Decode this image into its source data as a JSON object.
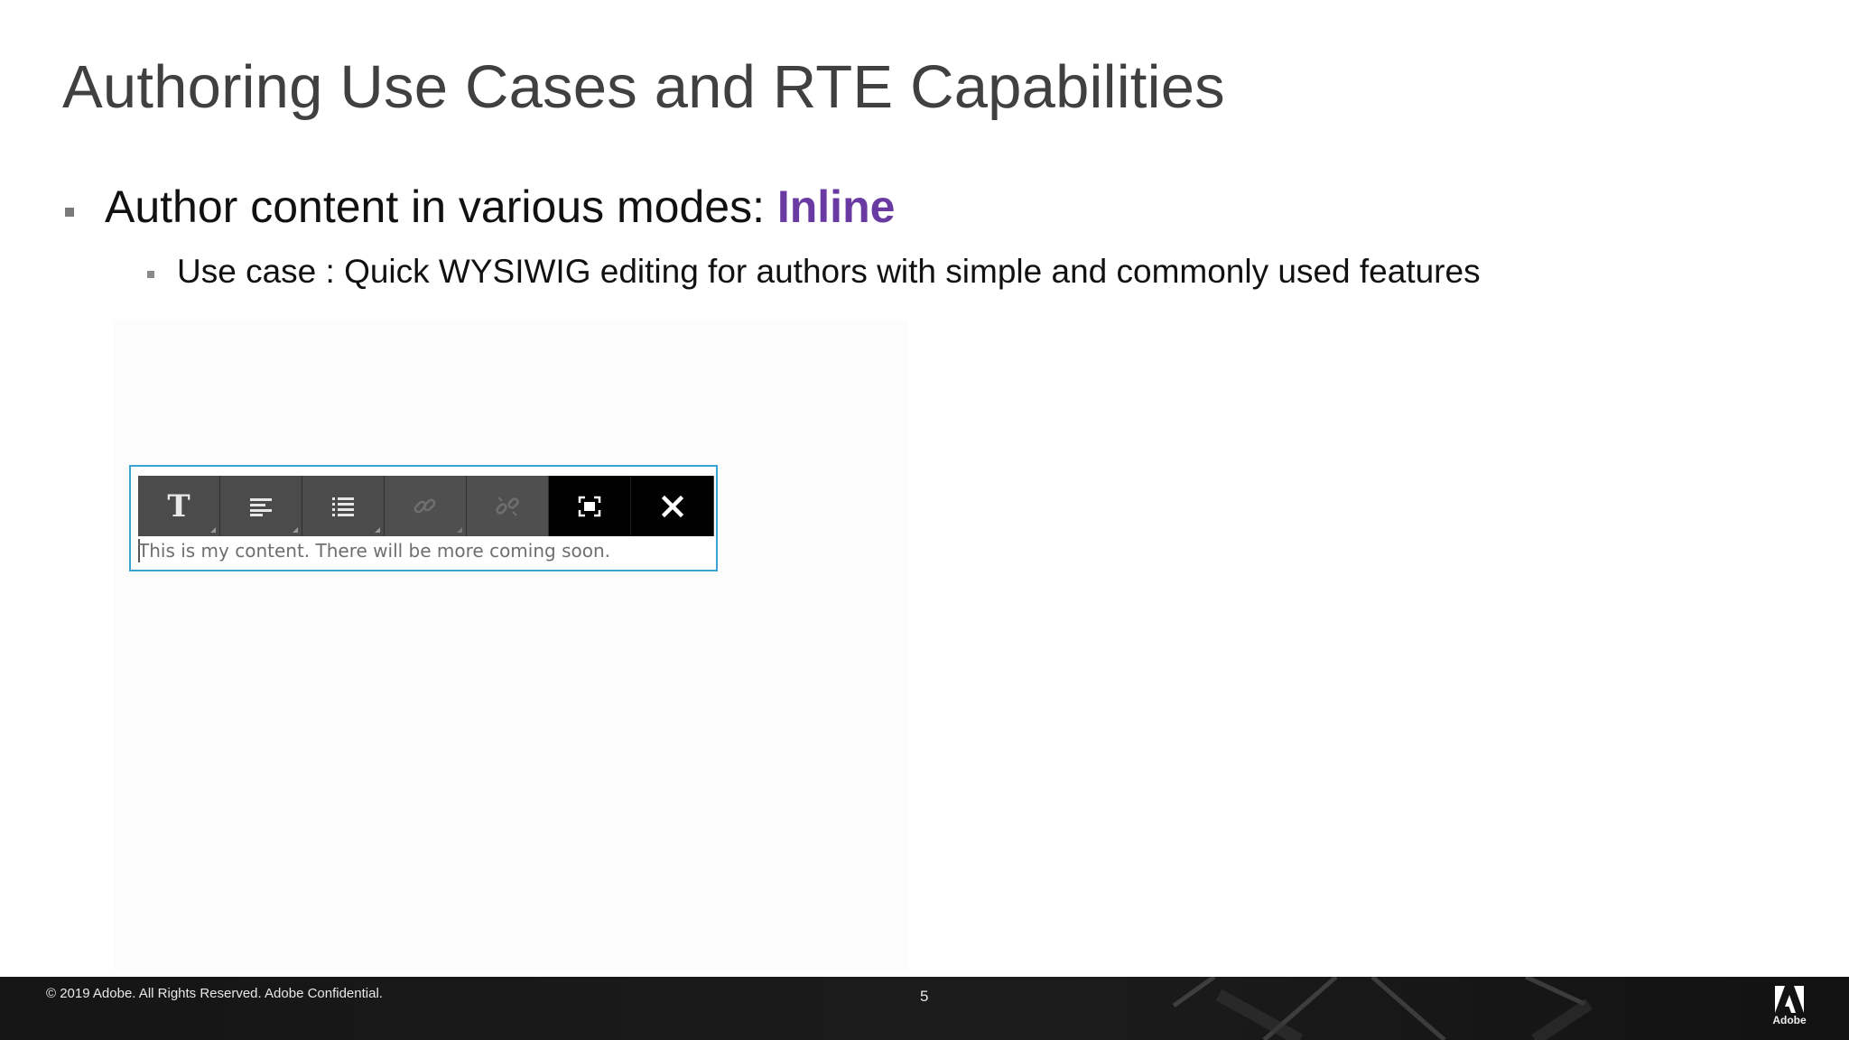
{
  "slide": {
    "title": "Authoring Use Cases and RTE Capabilities",
    "bullet1": {
      "text": "Author content in various modes: ",
      "highlight": "Inline"
    },
    "bullet2": {
      "text": "Use case : Quick WYSIWIG editing for authors with simple and commonly used features"
    }
  },
  "editor": {
    "toolbar": [
      {
        "name": "format-text",
        "icon": "text-format-icon",
        "enabled": true
      },
      {
        "name": "justify",
        "icon": "align-left-icon",
        "enabled": true
      },
      {
        "name": "lists",
        "icon": "list-icon",
        "enabled": true
      },
      {
        "name": "link",
        "icon": "link-icon",
        "enabled": false
      },
      {
        "name": "unlink",
        "icon": "unlink-icon",
        "enabled": false
      },
      {
        "name": "fullscreen",
        "icon": "fullscreen-icon",
        "enabled": true
      },
      {
        "name": "close",
        "icon": "close-icon",
        "enabled": true
      }
    ],
    "content": "This is my content. There will be more coming soon."
  },
  "footer": {
    "copyright": "© 2019 Adobe.  All Rights Reserved.  Adobe Confidential.",
    "page_number": "5",
    "logo_text": "Adobe"
  },
  "colors": {
    "title": "#404040",
    "highlight": "#6a3aa3",
    "editor_border": "#3aa3d3",
    "footer_bg": "#151515"
  }
}
